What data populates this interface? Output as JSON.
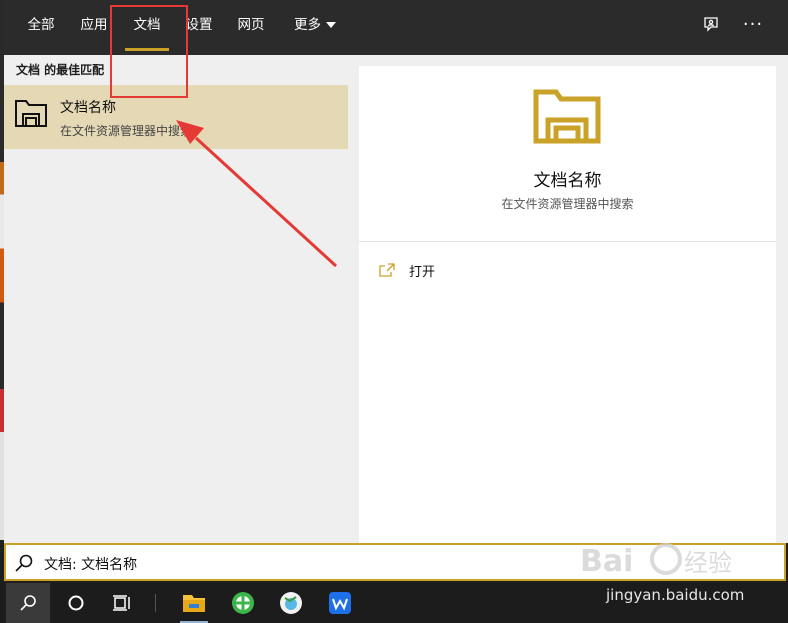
{
  "tabs": [
    {
      "label": "全部"
    },
    {
      "label": "应用"
    },
    {
      "label": "文档"
    },
    {
      "label": "设置"
    },
    {
      "label": "网页"
    },
    {
      "label": "更多"
    }
  ],
  "active_tab": "文档",
  "topbar_icons": [
    "feedback-icon",
    "more-options-icon"
  ],
  "results": {
    "section_title": "文档 的最佳匹配",
    "best_match": {
      "name": "文档名称",
      "subtitle": "在文件资源管理器中搜索",
      "icon": "folder-icon"
    }
  },
  "preview": {
    "title": "文档名称",
    "subtitle": "在文件资源管理器中搜索",
    "icon": "folder-icon",
    "actions": [
      {
        "label": "打开",
        "icon": "open-icon"
      }
    ]
  },
  "search": {
    "value": "文档: 文档名称",
    "icon": "search-icon"
  },
  "taskbar": {
    "items": [
      "search-icon",
      "cortana-icon",
      "task-view-icon",
      "file-explorer-icon",
      "browser-icon",
      "app-icon",
      "wps-icon"
    ]
  },
  "watermark": {
    "url": "jingyan.baidu.com"
  },
  "colors": {
    "accent": "#c9a227",
    "selected_bg": "#e5d8b5",
    "topbar_bg": "#2b2b2b",
    "annotation": "#e53935"
  }
}
